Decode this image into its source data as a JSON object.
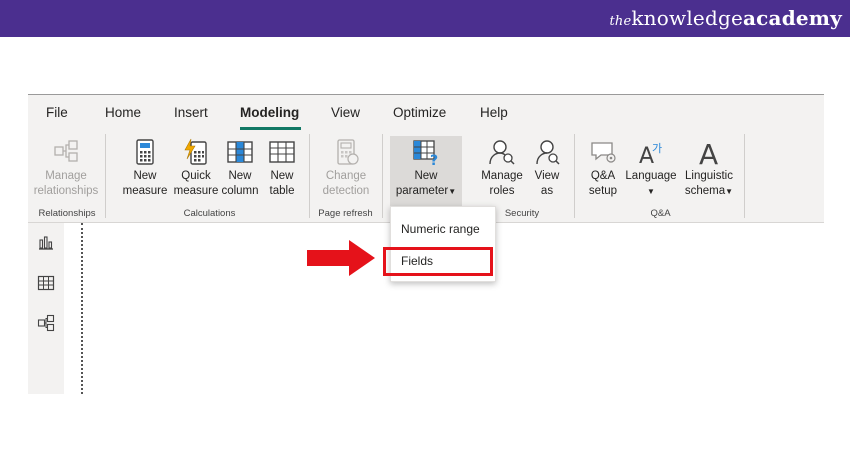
{
  "brand": {
    "prefix": "the",
    "part1": "knowledge",
    "part2": "academy"
  },
  "menu": {
    "file": "File",
    "home": "Home",
    "insert": "Insert",
    "modeling": "Modeling",
    "view": "View",
    "optimize": "Optimize",
    "help": "Help",
    "active": "Modeling"
  },
  "ribbon": {
    "manage_rel": {
      "l1": "Manage",
      "l2": "relationships"
    },
    "new_measure": {
      "l1": "New",
      "l2": "measure"
    },
    "quick_measure": {
      "l1": "Quick",
      "l2": "measure"
    },
    "new_column": {
      "l1": "New",
      "l2": "column"
    },
    "new_table": {
      "l1": "New",
      "l2": "table"
    },
    "change_detection": {
      "l1": "Change",
      "l2": "detection"
    },
    "new_parameter": {
      "l1": "New",
      "l2": "parameter"
    },
    "manage_roles": {
      "l1": "Manage",
      "l2": "roles"
    },
    "view_as": {
      "l1": "View",
      "l2": "as"
    },
    "qa_setup": {
      "l1": "Q&A",
      "l2": "setup"
    },
    "language": {
      "l1": "Language"
    },
    "linguistic": {
      "l1": "Linguistic",
      "l2": "schema"
    },
    "groups": {
      "relationships": "Relationships",
      "calculations": "Calculations",
      "page_refresh": "Page refresh",
      "security": "Security",
      "qa": "Q&A"
    }
  },
  "dropdown": {
    "numeric_range": "Numeric range",
    "fields": "Fields"
  },
  "colors": {
    "header": "#4b2f8f",
    "accent": "#117865",
    "highlight": "#e5121a",
    "ribbon_bg": "#f3f2f1"
  },
  "icons": [
    "report-view-icon",
    "data-view-icon",
    "model-view-icon",
    "red-arrow-icon"
  ]
}
